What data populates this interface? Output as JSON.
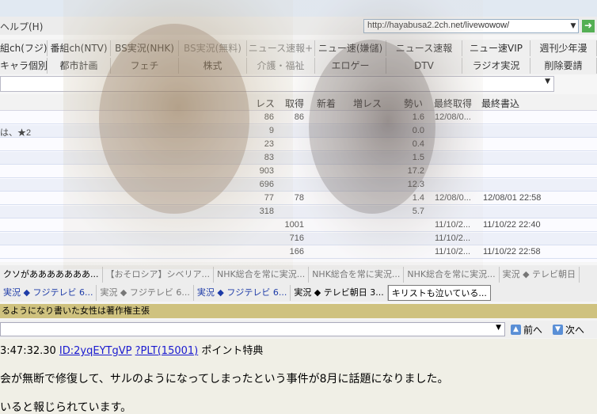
{
  "menu": {
    "help_label": "ヘルプ(H)"
  },
  "address": {
    "url": "http://hayabusa2.2ch.net/livewowow/"
  },
  "boards": {
    "row1": [
      "組ch(フジ)",
      "番組ch(NTV)",
      "BS実況(NHK)",
      "BS実況(無料)",
      "ニュース速報+",
      "ニュー速(嫌儲)",
      "ニュース速報",
      "ニュー速VIP",
      "週刊少年漫"
    ],
    "row2": [
      "キャラ個別",
      "都市計画",
      "フェチ",
      "株式",
      "介護・福祉",
      "エロゲー",
      "DTV",
      "ラジオ実況",
      "削除要請"
    ]
  },
  "threads": {
    "headers": {
      "res": "レス",
      "fetched": "取得",
      "new": "新着",
      "increase": "増レス",
      "momentum": "勢い",
      "last_fetch": "最終取得",
      "last_post": "最終書込"
    },
    "rows": [
      {
        "title": "",
        "res": "86",
        "fetched": "86",
        "new": "",
        "increase": "",
        "momentum": "1.6",
        "last_fetch": "12/08/0...",
        "last_post": ""
      },
      {
        "title": "は、★2",
        "res": "9",
        "fetched": "",
        "new": "",
        "increase": "",
        "momentum": "0.0",
        "last_fetch": "",
        "last_post": ""
      },
      {
        "title": "",
        "res": "23",
        "fetched": "",
        "new": "",
        "increase": "",
        "momentum": "0.4",
        "last_fetch": "",
        "last_post": ""
      },
      {
        "title": "",
        "res": "83",
        "fetched": "",
        "new": "",
        "increase": "",
        "momentum": "1.5",
        "last_fetch": "",
        "last_post": ""
      },
      {
        "title": "",
        "res": "903",
        "fetched": "",
        "new": "",
        "increase": "",
        "momentum": "17.2",
        "last_fetch": "",
        "last_post": ""
      },
      {
        "title": "",
        "res": "696",
        "fetched": "",
        "new": "",
        "increase": "",
        "momentum": "12.3",
        "last_fetch": "",
        "last_post": ""
      },
      {
        "title": "",
        "res": "77",
        "fetched": "78",
        "new": "",
        "increase": "",
        "momentum": "1.4",
        "last_fetch": "12/08/0...",
        "last_post": "12/08/01 22:58"
      },
      {
        "title": "",
        "res": "318",
        "fetched": "",
        "new": "",
        "increase": "",
        "momentum": "5.7",
        "last_fetch": "",
        "last_post": ""
      },
      {
        "title": "",
        "res": "",
        "fetched": "1001",
        "new": "",
        "increase": "",
        "momentum": "",
        "last_fetch": "11/10/2...",
        "last_post": "11/10/22 22:40"
      },
      {
        "title": "",
        "res": "",
        "fetched": "716",
        "new": "",
        "increase": "",
        "momentum": "",
        "last_fetch": "11/10/2...",
        "last_post": ""
      },
      {
        "title": "",
        "res": "",
        "fetched": "166",
        "new": "",
        "increase": "",
        "momentum": "",
        "last_fetch": "11/10/2...",
        "last_post": "11/10/22 22:58"
      }
    ]
  },
  "subtabs": {
    "row1": [
      "クソがあああああああ...",
      "【おそロシア】シベリア...",
      "NHK総合を常に実況...",
      "NHK総合を常に実況...",
      "NHK総合を常に実況...",
      "実況 ◆ テレビ朝日"
    ],
    "row2": [
      "実況 ◆ フジテレビ 6...",
      "実況 ◆ フジテレビ 6...",
      "実況 ◆ フジテレビ 6...",
      "実況 ◆ テレビ朝日 3...",
      "キリストも泣いている..."
    ]
  },
  "thread_title": "るようになり書いた女性は著作権主張",
  "nav": {
    "prev_label": "前へ",
    "next_label": "次へ"
  },
  "post": {
    "time_id_prefix": "3:47:32.30 ",
    "id_text": "ID:2yqEYTgVP",
    "plt_text": "?PLT(15001)",
    "point_text": " ポイント特典",
    "line1": "会が無断で修復して、サルのようになってしまったという事件が8月に話題になりました。",
    "line2": "いると報じられています。"
  },
  "colors": {
    "title_bar": "#cfc27f",
    "link": "#1a1ad0",
    "go_button": "#2f9e2f"
  }
}
